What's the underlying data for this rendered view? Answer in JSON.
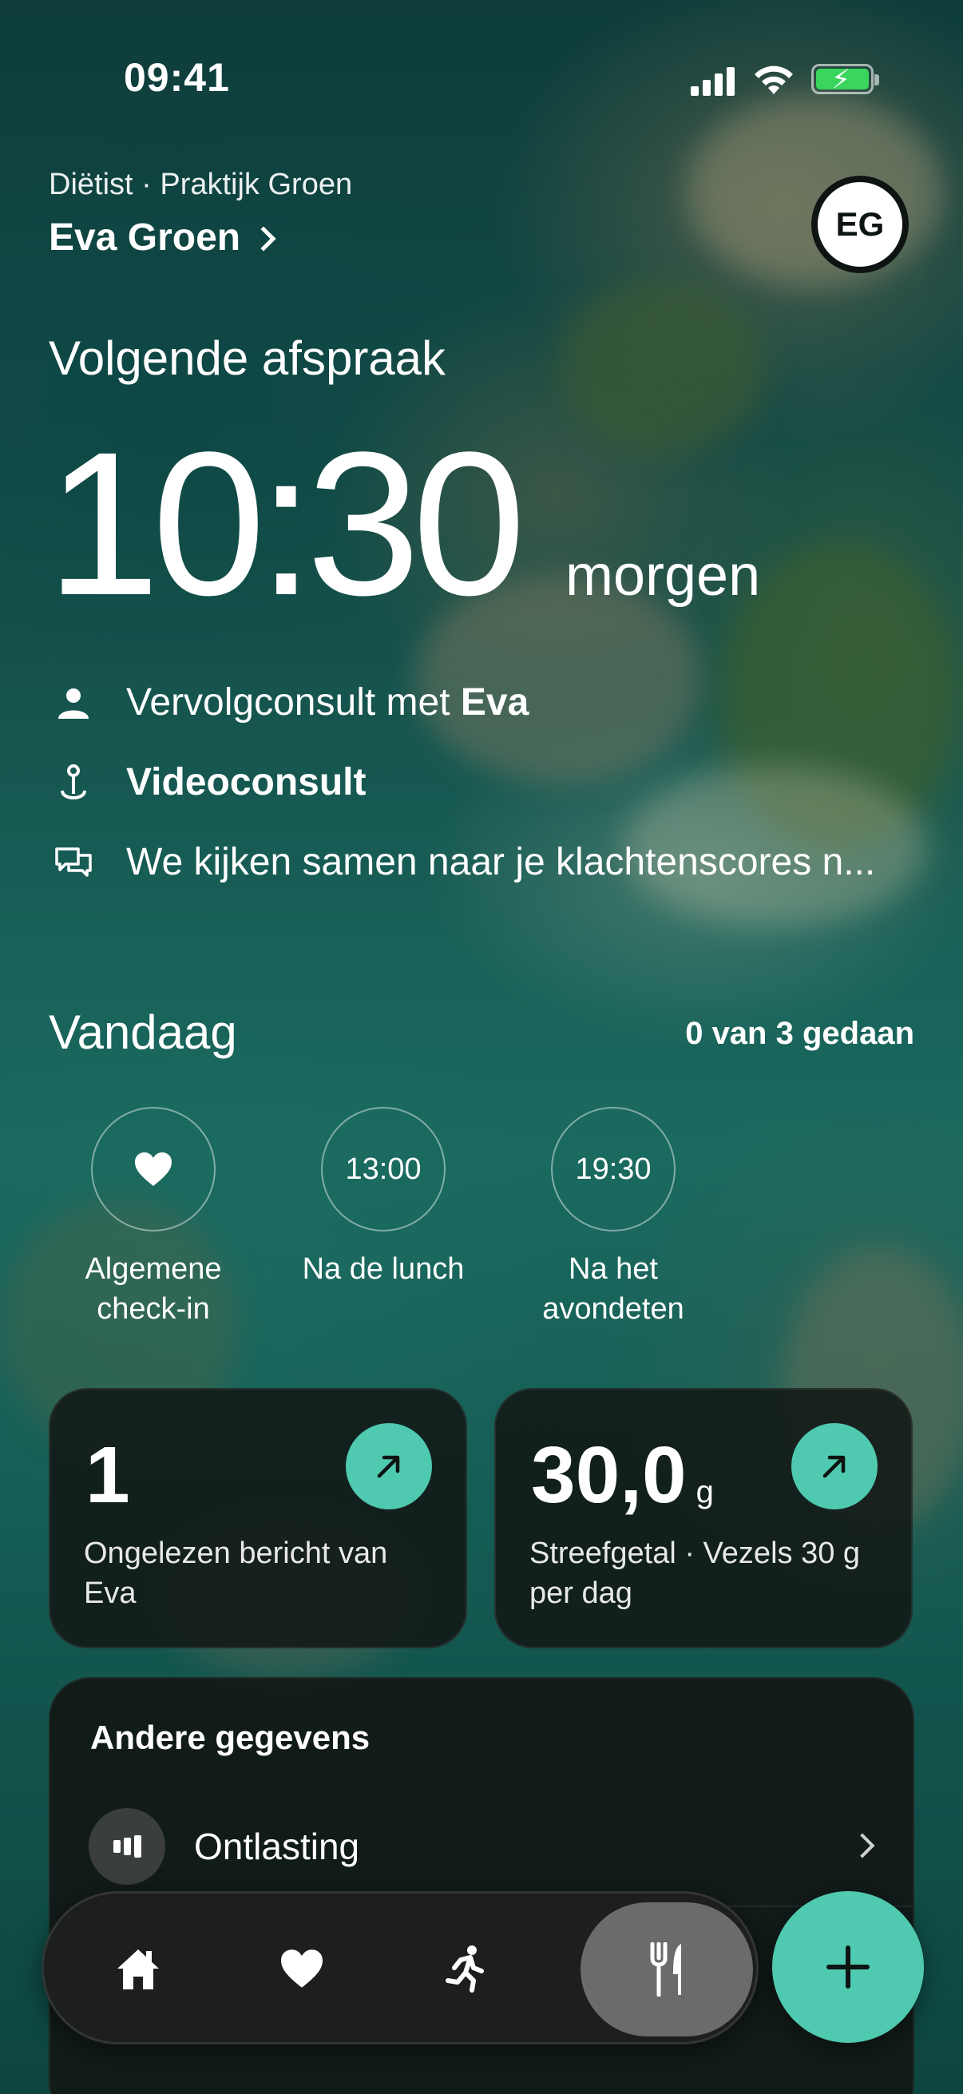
{
  "status_bar": {
    "time": "09:41"
  },
  "header": {
    "provider_subtitle": "Diëtist · Praktijk Groen",
    "provider_name": "Eva Groen",
    "avatar_initials": "EG"
  },
  "next_appointment": {
    "title": "Volgende afspraak",
    "time": "10:30",
    "when": "morgen",
    "consult_prefix": "Vervolgconsult met ",
    "consult_with": "Eva",
    "type": "Videoconsult",
    "note": "We kijken samen naar je klachtenscores n..."
  },
  "today": {
    "title": "Vandaag",
    "progress": "0 van 3 gedaan",
    "tasks": [
      {
        "badge": "",
        "icon": "heart-icon",
        "label_line1": "Algemene",
        "label_line2": "check-in"
      },
      {
        "badge": "13:00",
        "label_line1": "Na de lunch",
        "label_line2": ""
      },
      {
        "badge": "19:30",
        "label_line1": "Na het",
        "label_line2": "avondeten"
      }
    ]
  },
  "cards": {
    "messages": {
      "value": "1",
      "description": "Ongelezen bericht van Eva"
    },
    "fiber": {
      "value": "30,0",
      "unit": "g",
      "description": "Streefgetal · Vezels 30 g per dag"
    }
  },
  "other_data": {
    "title": "Andere gegevens",
    "rows": [
      {
        "label": "Ontlasting",
        "icon": "bar-chart-icon"
      }
    ]
  },
  "tabbar": {
    "tabs": [
      {
        "icon": "home-icon",
        "active": false
      },
      {
        "icon": "heart-icon",
        "active": false
      },
      {
        "icon": "running-icon",
        "active": false
      },
      {
        "icon": "fork-knife-icon",
        "active": true
      }
    ],
    "fab_icon": "plus-icon"
  },
  "colors": {
    "accent": "#4fc9b0",
    "battery": "#39d55d",
    "card_bg": "#121816"
  }
}
